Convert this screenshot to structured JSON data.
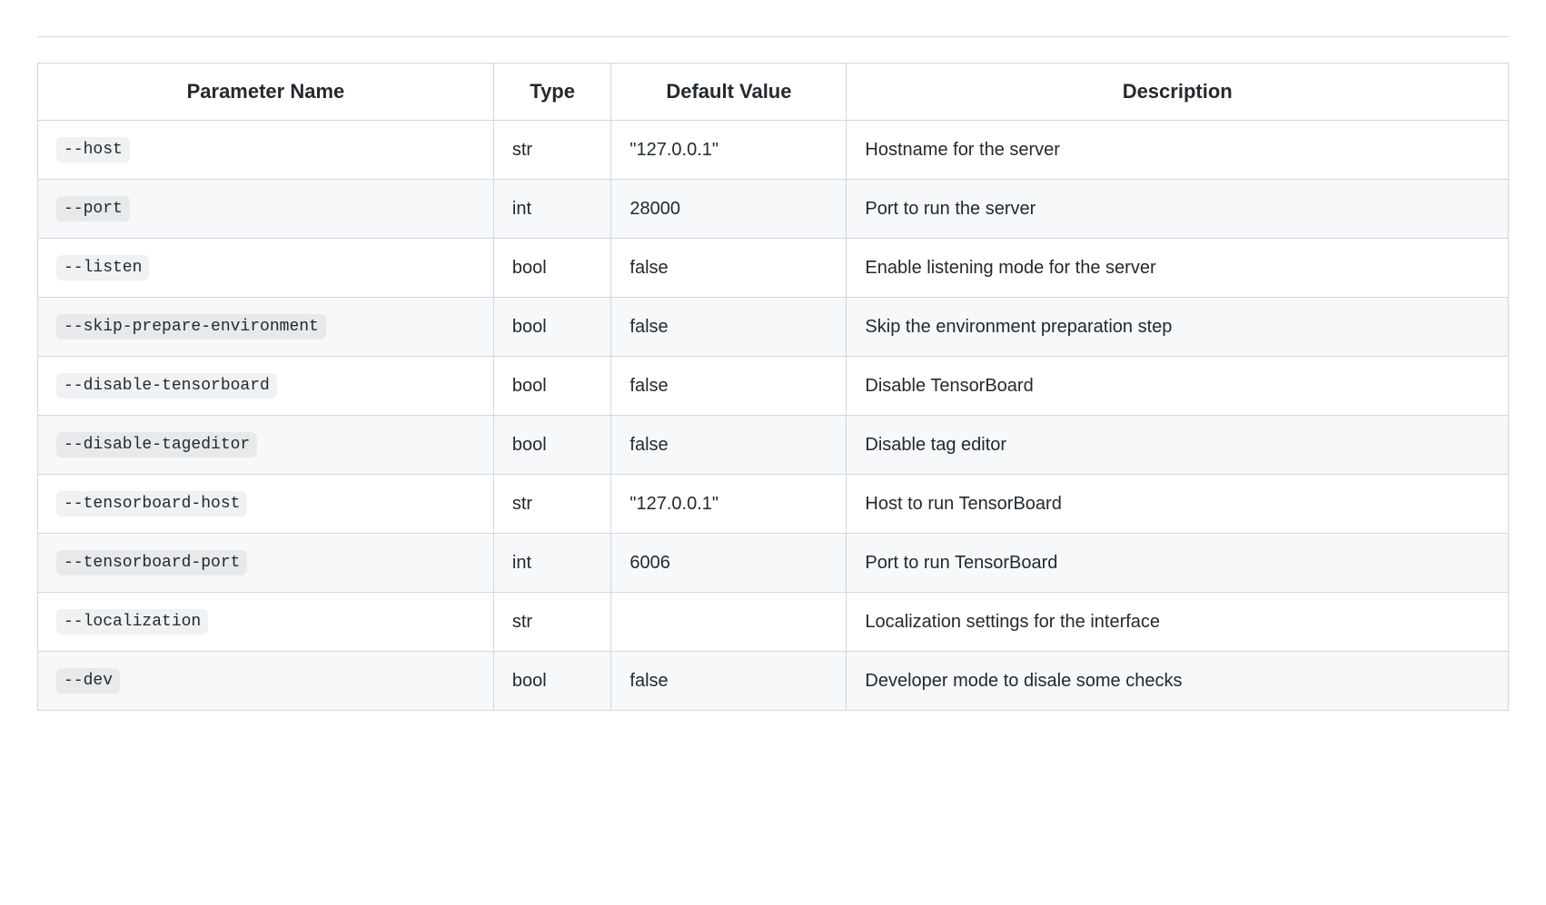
{
  "table": {
    "headers": {
      "parameter": "Parameter Name",
      "type": "Type",
      "default": "Default Value",
      "description": "Description"
    },
    "rows": [
      {
        "param": "--host",
        "type": "str",
        "default": "\"127.0.0.1\"",
        "description": "Hostname for the server"
      },
      {
        "param": "--port",
        "type": "int",
        "default": "28000",
        "description": "Port to run the server"
      },
      {
        "param": "--listen",
        "type": "bool",
        "default": "false",
        "description": "Enable listening mode for the server"
      },
      {
        "param": "--skip-prepare-environment",
        "type": "bool",
        "default": "false",
        "description": "Skip the environment preparation step"
      },
      {
        "param": "--disable-tensorboard",
        "type": "bool",
        "default": "false",
        "description": "Disable TensorBoard"
      },
      {
        "param": "--disable-tageditor",
        "type": "bool",
        "default": "false",
        "description": "Disable tag editor"
      },
      {
        "param": "--tensorboard-host",
        "type": "str",
        "default": "\"127.0.0.1\"",
        "description": "Host to run TensorBoard"
      },
      {
        "param": "--tensorboard-port",
        "type": "int",
        "default": "6006",
        "description": "Port to run TensorBoard"
      },
      {
        "param": "--localization",
        "type": "str",
        "default": "",
        "description": "Localization settings for the interface"
      },
      {
        "param": "--dev",
        "type": "bool",
        "default": "false",
        "description": "Developer mode to disale some checks"
      }
    ]
  }
}
